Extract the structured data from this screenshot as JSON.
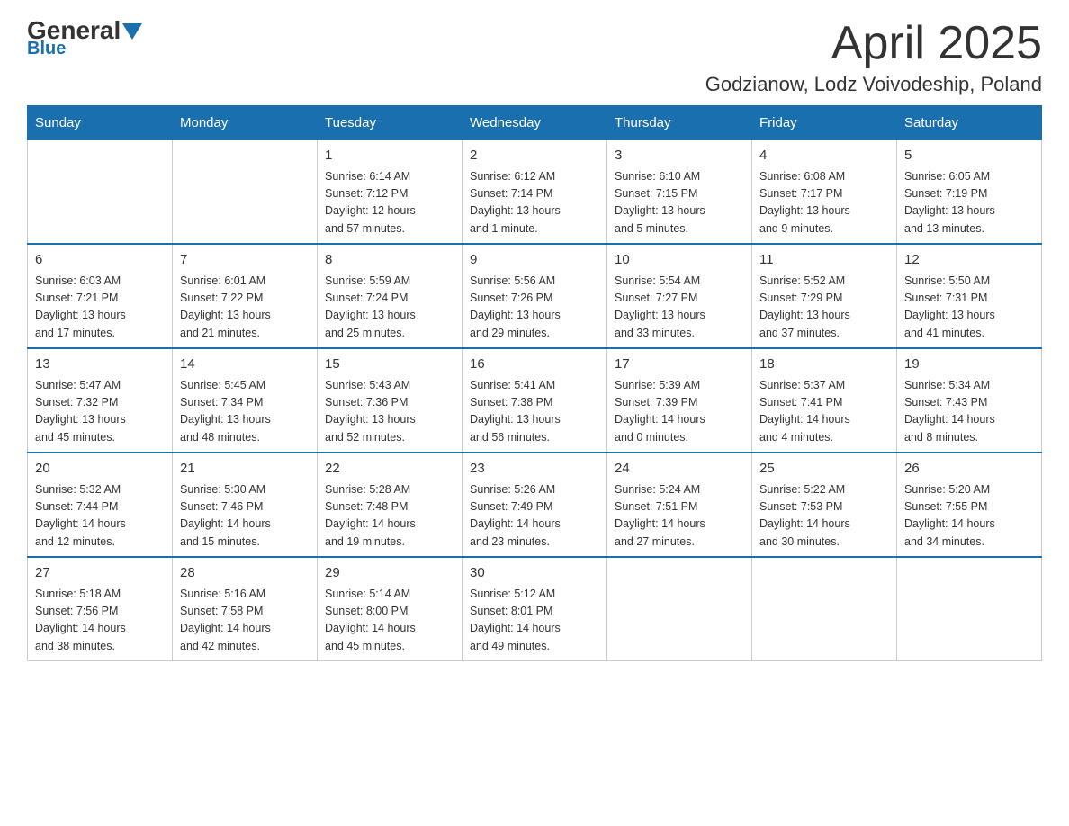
{
  "logo": {
    "text1": "General",
    "text2": "Blue"
  },
  "header": {
    "month": "April 2025",
    "location": "Godzianow, Lodz Voivodeship, Poland"
  },
  "weekdays": [
    "Sunday",
    "Monday",
    "Tuesday",
    "Wednesday",
    "Thursday",
    "Friday",
    "Saturday"
  ],
  "weeks": [
    [
      {
        "day": "",
        "info": ""
      },
      {
        "day": "",
        "info": ""
      },
      {
        "day": "1",
        "info": "Sunrise: 6:14 AM\nSunset: 7:12 PM\nDaylight: 12 hours\nand 57 minutes."
      },
      {
        "day": "2",
        "info": "Sunrise: 6:12 AM\nSunset: 7:14 PM\nDaylight: 13 hours\nand 1 minute."
      },
      {
        "day": "3",
        "info": "Sunrise: 6:10 AM\nSunset: 7:15 PM\nDaylight: 13 hours\nand 5 minutes."
      },
      {
        "day": "4",
        "info": "Sunrise: 6:08 AM\nSunset: 7:17 PM\nDaylight: 13 hours\nand 9 minutes."
      },
      {
        "day": "5",
        "info": "Sunrise: 6:05 AM\nSunset: 7:19 PM\nDaylight: 13 hours\nand 13 minutes."
      }
    ],
    [
      {
        "day": "6",
        "info": "Sunrise: 6:03 AM\nSunset: 7:21 PM\nDaylight: 13 hours\nand 17 minutes."
      },
      {
        "day": "7",
        "info": "Sunrise: 6:01 AM\nSunset: 7:22 PM\nDaylight: 13 hours\nand 21 minutes."
      },
      {
        "day": "8",
        "info": "Sunrise: 5:59 AM\nSunset: 7:24 PM\nDaylight: 13 hours\nand 25 minutes."
      },
      {
        "day": "9",
        "info": "Sunrise: 5:56 AM\nSunset: 7:26 PM\nDaylight: 13 hours\nand 29 minutes."
      },
      {
        "day": "10",
        "info": "Sunrise: 5:54 AM\nSunset: 7:27 PM\nDaylight: 13 hours\nand 33 minutes."
      },
      {
        "day": "11",
        "info": "Sunrise: 5:52 AM\nSunset: 7:29 PM\nDaylight: 13 hours\nand 37 minutes."
      },
      {
        "day": "12",
        "info": "Sunrise: 5:50 AM\nSunset: 7:31 PM\nDaylight: 13 hours\nand 41 minutes."
      }
    ],
    [
      {
        "day": "13",
        "info": "Sunrise: 5:47 AM\nSunset: 7:32 PM\nDaylight: 13 hours\nand 45 minutes."
      },
      {
        "day": "14",
        "info": "Sunrise: 5:45 AM\nSunset: 7:34 PM\nDaylight: 13 hours\nand 48 minutes."
      },
      {
        "day": "15",
        "info": "Sunrise: 5:43 AM\nSunset: 7:36 PM\nDaylight: 13 hours\nand 52 minutes."
      },
      {
        "day": "16",
        "info": "Sunrise: 5:41 AM\nSunset: 7:38 PM\nDaylight: 13 hours\nand 56 minutes."
      },
      {
        "day": "17",
        "info": "Sunrise: 5:39 AM\nSunset: 7:39 PM\nDaylight: 14 hours\nand 0 minutes."
      },
      {
        "day": "18",
        "info": "Sunrise: 5:37 AM\nSunset: 7:41 PM\nDaylight: 14 hours\nand 4 minutes."
      },
      {
        "day": "19",
        "info": "Sunrise: 5:34 AM\nSunset: 7:43 PM\nDaylight: 14 hours\nand 8 minutes."
      }
    ],
    [
      {
        "day": "20",
        "info": "Sunrise: 5:32 AM\nSunset: 7:44 PM\nDaylight: 14 hours\nand 12 minutes."
      },
      {
        "day": "21",
        "info": "Sunrise: 5:30 AM\nSunset: 7:46 PM\nDaylight: 14 hours\nand 15 minutes."
      },
      {
        "day": "22",
        "info": "Sunrise: 5:28 AM\nSunset: 7:48 PM\nDaylight: 14 hours\nand 19 minutes."
      },
      {
        "day": "23",
        "info": "Sunrise: 5:26 AM\nSunset: 7:49 PM\nDaylight: 14 hours\nand 23 minutes."
      },
      {
        "day": "24",
        "info": "Sunrise: 5:24 AM\nSunset: 7:51 PM\nDaylight: 14 hours\nand 27 minutes."
      },
      {
        "day": "25",
        "info": "Sunrise: 5:22 AM\nSunset: 7:53 PM\nDaylight: 14 hours\nand 30 minutes."
      },
      {
        "day": "26",
        "info": "Sunrise: 5:20 AM\nSunset: 7:55 PM\nDaylight: 14 hours\nand 34 minutes."
      }
    ],
    [
      {
        "day": "27",
        "info": "Sunrise: 5:18 AM\nSunset: 7:56 PM\nDaylight: 14 hours\nand 38 minutes."
      },
      {
        "day": "28",
        "info": "Sunrise: 5:16 AM\nSunset: 7:58 PM\nDaylight: 14 hours\nand 42 minutes."
      },
      {
        "day": "29",
        "info": "Sunrise: 5:14 AM\nSunset: 8:00 PM\nDaylight: 14 hours\nand 45 minutes."
      },
      {
        "day": "30",
        "info": "Sunrise: 5:12 AM\nSunset: 8:01 PM\nDaylight: 14 hours\nand 49 minutes."
      },
      {
        "day": "",
        "info": ""
      },
      {
        "day": "",
        "info": ""
      },
      {
        "day": "",
        "info": ""
      }
    ]
  ]
}
